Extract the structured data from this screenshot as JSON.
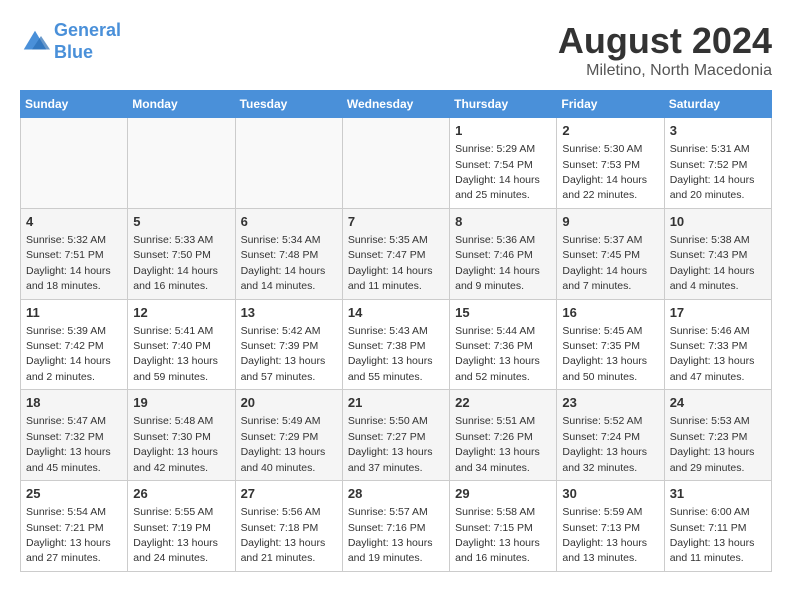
{
  "logo": {
    "line1": "General",
    "line2": "Blue"
  },
  "title": "August 2024",
  "subtitle": "Miletino, North Macedonia",
  "days_of_week": [
    "Sunday",
    "Monday",
    "Tuesday",
    "Wednesday",
    "Thursday",
    "Friday",
    "Saturday"
  ],
  "weeks": [
    [
      {
        "day": "",
        "info": ""
      },
      {
        "day": "",
        "info": ""
      },
      {
        "day": "",
        "info": ""
      },
      {
        "day": "",
        "info": ""
      },
      {
        "day": "1",
        "info": "Sunrise: 5:29 AM\nSunset: 7:54 PM\nDaylight: 14 hours\nand 25 minutes."
      },
      {
        "day": "2",
        "info": "Sunrise: 5:30 AM\nSunset: 7:53 PM\nDaylight: 14 hours\nand 22 minutes."
      },
      {
        "day": "3",
        "info": "Sunrise: 5:31 AM\nSunset: 7:52 PM\nDaylight: 14 hours\nand 20 minutes."
      }
    ],
    [
      {
        "day": "4",
        "info": "Sunrise: 5:32 AM\nSunset: 7:51 PM\nDaylight: 14 hours\nand 18 minutes."
      },
      {
        "day": "5",
        "info": "Sunrise: 5:33 AM\nSunset: 7:50 PM\nDaylight: 14 hours\nand 16 minutes."
      },
      {
        "day": "6",
        "info": "Sunrise: 5:34 AM\nSunset: 7:48 PM\nDaylight: 14 hours\nand 14 minutes."
      },
      {
        "day": "7",
        "info": "Sunrise: 5:35 AM\nSunset: 7:47 PM\nDaylight: 14 hours\nand 11 minutes."
      },
      {
        "day": "8",
        "info": "Sunrise: 5:36 AM\nSunset: 7:46 PM\nDaylight: 14 hours\nand 9 minutes."
      },
      {
        "day": "9",
        "info": "Sunrise: 5:37 AM\nSunset: 7:45 PM\nDaylight: 14 hours\nand 7 minutes."
      },
      {
        "day": "10",
        "info": "Sunrise: 5:38 AM\nSunset: 7:43 PM\nDaylight: 14 hours\nand 4 minutes."
      }
    ],
    [
      {
        "day": "11",
        "info": "Sunrise: 5:39 AM\nSunset: 7:42 PM\nDaylight: 14 hours\nand 2 minutes."
      },
      {
        "day": "12",
        "info": "Sunrise: 5:41 AM\nSunset: 7:40 PM\nDaylight: 13 hours\nand 59 minutes."
      },
      {
        "day": "13",
        "info": "Sunrise: 5:42 AM\nSunset: 7:39 PM\nDaylight: 13 hours\nand 57 minutes."
      },
      {
        "day": "14",
        "info": "Sunrise: 5:43 AM\nSunset: 7:38 PM\nDaylight: 13 hours\nand 55 minutes."
      },
      {
        "day": "15",
        "info": "Sunrise: 5:44 AM\nSunset: 7:36 PM\nDaylight: 13 hours\nand 52 minutes."
      },
      {
        "day": "16",
        "info": "Sunrise: 5:45 AM\nSunset: 7:35 PM\nDaylight: 13 hours\nand 50 minutes."
      },
      {
        "day": "17",
        "info": "Sunrise: 5:46 AM\nSunset: 7:33 PM\nDaylight: 13 hours\nand 47 minutes."
      }
    ],
    [
      {
        "day": "18",
        "info": "Sunrise: 5:47 AM\nSunset: 7:32 PM\nDaylight: 13 hours\nand 45 minutes."
      },
      {
        "day": "19",
        "info": "Sunrise: 5:48 AM\nSunset: 7:30 PM\nDaylight: 13 hours\nand 42 minutes."
      },
      {
        "day": "20",
        "info": "Sunrise: 5:49 AM\nSunset: 7:29 PM\nDaylight: 13 hours\nand 40 minutes."
      },
      {
        "day": "21",
        "info": "Sunrise: 5:50 AM\nSunset: 7:27 PM\nDaylight: 13 hours\nand 37 minutes."
      },
      {
        "day": "22",
        "info": "Sunrise: 5:51 AM\nSunset: 7:26 PM\nDaylight: 13 hours\nand 34 minutes."
      },
      {
        "day": "23",
        "info": "Sunrise: 5:52 AM\nSunset: 7:24 PM\nDaylight: 13 hours\nand 32 minutes."
      },
      {
        "day": "24",
        "info": "Sunrise: 5:53 AM\nSunset: 7:23 PM\nDaylight: 13 hours\nand 29 minutes."
      }
    ],
    [
      {
        "day": "25",
        "info": "Sunrise: 5:54 AM\nSunset: 7:21 PM\nDaylight: 13 hours\nand 27 minutes."
      },
      {
        "day": "26",
        "info": "Sunrise: 5:55 AM\nSunset: 7:19 PM\nDaylight: 13 hours\nand 24 minutes."
      },
      {
        "day": "27",
        "info": "Sunrise: 5:56 AM\nSunset: 7:18 PM\nDaylight: 13 hours\nand 21 minutes."
      },
      {
        "day": "28",
        "info": "Sunrise: 5:57 AM\nSunset: 7:16 PM\nDaylight: 13 hours\nand 19 minutes."
      },
      {
        "day": "29",
        "info": "Sunrise: 5:58 AM\nSunset: 7:15 PM\nDaylight: 13 hours\nand 16 minutes."
      },
      {
        "day": "30",
        "info": "Sunrise: 5:59 AM\nSunset: 7:13 PM\nDaylight: 13 hours\nand 13 minutes."
      },
      {
        "day": "31",
        "info": "Sunrise: 6:00 AM\nSunset: 7:11 PM\nDaylight: 13 hours\nand 11 minutes."
      }
    ]
  ]
}
